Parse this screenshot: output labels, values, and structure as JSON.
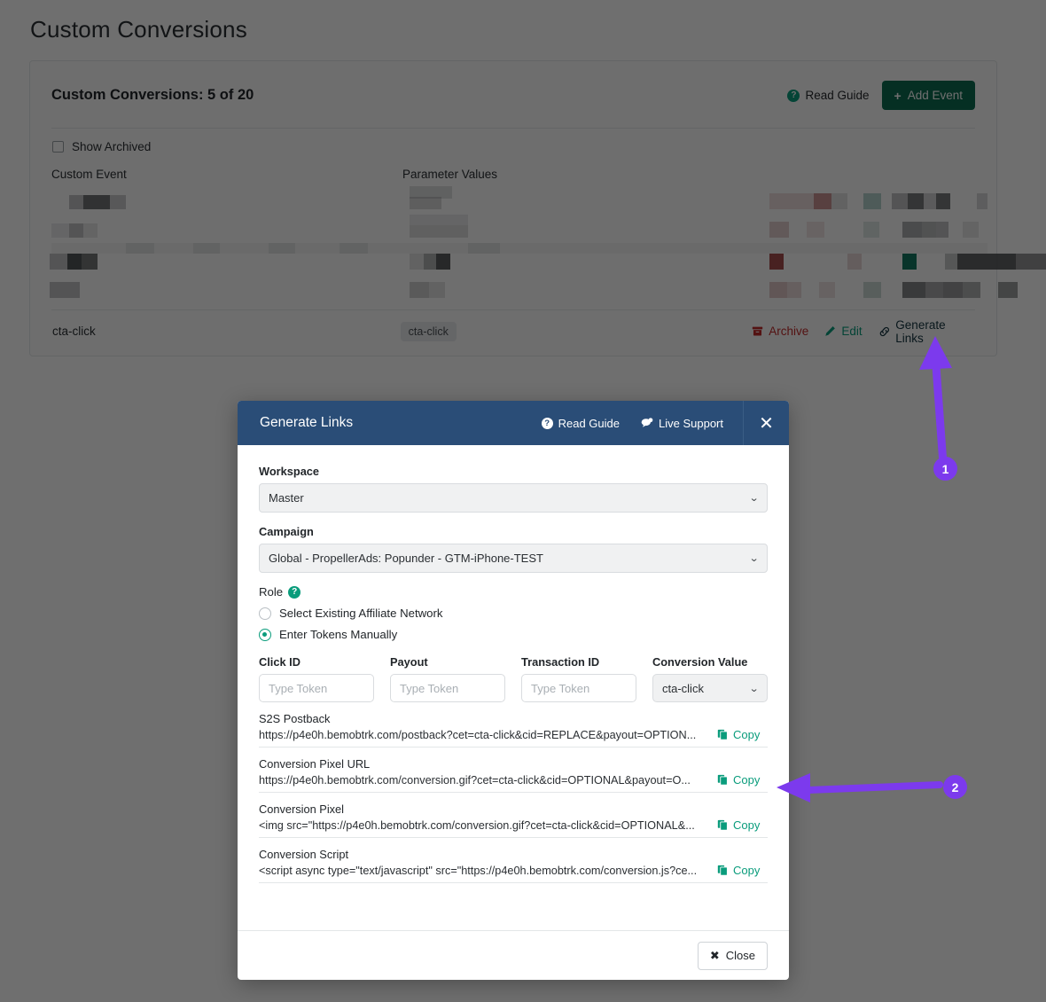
{
  "page": {
    "title": "Custom Conversions",
    "card_title": "Custom Conversions: 5 of 20",
    "read_guide": "Read Guide",
    "add_event": "Add Event",
    "show_archived": "Show Archived",
    "columns": {
      "custom_event": "Custom Event",
      "parameter_values": "Parameter Values"
    },
    "row": {
      "event": "cta-click",
      "param": "cta-click",
      "archive": "Archive",
      "edit": "Edit",
      "generate_links": "Generate Links"
    },
    "icons": {
      "question": "?",
      "plus": "+",
      "archive": "archive-box-icon",
      "edit": "pencil-icon",
      "link": "link-icon"
    }
  },
  "modal": {
    "title": "Generate Links",
    "read_guide": "Read Guide",
    "live_support": "Live Support",
    "close_x": "✕",
    "workspace": {
      "label": "Workspace",
      "value": "Master"
    },
    "campaign": {
      "label": "Campaign",
      "value": "Global - PropellerAds: Popunder - GTM-iPhone-TEST"
    },
    "role": {
      "label": "Role",
      "help": "?",
      "options": [
        {
          "label": "Select Existing Affiliate Network",
          "selected": false
        },
        {
          "label": "Enter Tokens Manually",
          "selected": true
        }
      ]
    },
    "tokens": [
      {
        "label": "Click ID",
        "value": "",
        "placeholder": "Type Token",
        "type": "input"
      },
      {
        "label": "Payout",
        "value": "",
        "placeholder": "Type Token",
        "type": "input"
      },
      {
        "label": "Transaction ID",
        "value": "",
        "placeholder": "Type Token",
        "type": "input"
      },
      {
        "label": "Conversion Value",
        "value": "cta-click",
        "placeholder": "",
        "type": "select"
      }
    ],
    "links": [
      {
        "label": "S2S Postback",
        "value": "https://p4e0h.bemobtrk.com/postback?cet=cta-click&cid=REPLACE&payout=OPTION...",
        "copy": "Copy"
      },
      {
        "label": "Conversion Pixel URL",
        "value": "https://p4e0h.bemobtrk.com/conversion.gif?cet=cta-click&cid=OPTIONAL&payout=O...",
        "copy": "Copy"
      },
      {
        "label": "Conversion Pixel",
        "value": "<img src=\"https://p4e0h.bemobtrk.com/conversion.gif?cet=cta-click&cid=OPTIONAL&...",
        "copy": "Copy"
      },
      {
        "label": "Conversion Script",
        "value": "<script async type=\"text/javascript\" src=\"https://p4e0h.bemobtrk.com/conversion.js?ce...",
        "copy": "Copy"
      }
    ],
    "close_button": "Close"
  },
  "annotations": [
    {
      "number": "1"
    },
    {
      "number": "2"
    }
  ],
  "colors": {
    "accent_teal": "#0a9c7c",
    "green_button": "#0d6c52",
    "modal_header_blue": "#2a4d77",
    "annotation_purple": "#7c3aed",
    "archive_red": "#c02b2b"
  }
}
